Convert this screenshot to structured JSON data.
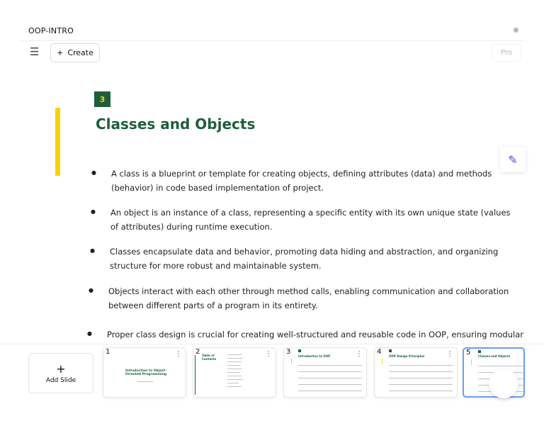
{
  "header": {
    "title": "OOP-INTRO",
    "create_label": "Create",
    "pro_label": "Pro"
  },
  "slide": {
    "number": "3",
    "title": "Classes and Objects",
    "bullets": [
      "A class is a blueprint or template for creating objects, defining attributes (data) and methods (behavior) in code based implementation of project.",
      "An object is an instance of a class, representing a specific entity with its own unique state (values of attributes) during runtime execution.",
      "Classes encapsulate data and behavior, promoting data hiding and abstraction, and organizing structure for more robust and maintainable system.",
      "Objects interact with each other through method calls, enabling communication and collaboration between different parts of a program in its entirety.",
      "Proper class design is crucial for creating well-structured and reusable code in OOP, ensuring modularity"
    ]
  },
  "strip": {
    "add_label": "Add Slide",
    "thumbs": [
      {
        "n": "1",
        "title": "Introduction to Object-Oriented Programming"
      },
      {
        "n": "2",
        "title": "Table of Contents"
      },
      {
        "n": "3",
        "title": "Introduction to OOP"
      },
      {
        "n": "4",
        "title": "OOP Design Principles"
      },
      {
        "n": "5",
        "title": "Classes and Objects"
      }
    ]
  }
}
